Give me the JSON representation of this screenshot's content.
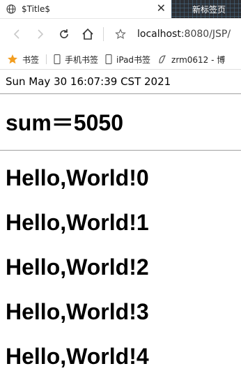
{
  "tab": {
    "title": "$Title$"
  },
  "new_tab": {
    "label": "新标签页"
  },
  "address_bar": {
    "host": "localhost",
    "rest": ":8080/JSP/"
  },
  "bookmarks": [
    {
      "label": "书签",
      "icon": "star-icon"
    },
    {
      "label": "手机书签",
      "icon": "phone-icon"
    },
    {
      "label": "iPad书签",
      "icon": "tablet-icon"
    },
    {
      "label": "zrm0612 - 博",
      "icon": "site-icon"
    }
  ],
  "page": {
    "date": "Sun May 30 16:07:39 CST 2021",
    "sum": "sum＝5050",
    "hello_lines": [
      "Hello,World!0",
      "Hello,World!1",
      "Hello,World!2",
      "Hello,World!3",
      "Hello,World!4"
    ]
  }
}
